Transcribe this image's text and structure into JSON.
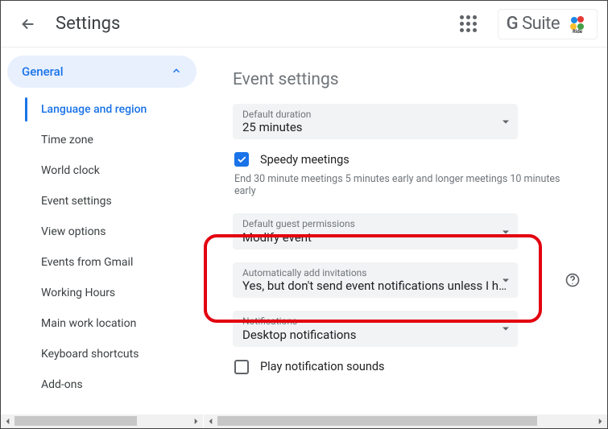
{
  "header": {
    "title": "Settings",
    "suite_label": "G Suite",
    "profile_label": "Soul\nRide"
  },
  "sidebar": {
    "section": "General",
    "items": [
      {
        "label": "Language and region",
        "active": true
      },
      {
        "label": "Time zone"
      },
      {
        "label": "World clock"
      },
      {
        "label": "Event settings"
      },
      {
        "label": "View options"
      },
      {
        "label": "Events from Gmail"
      },
      {
        "label": "Working Hours"
      },
      {
        "label": "Main work location"
      },
      {
        "label": "Keyboard shortcuts"
      },
      {
        "label": "Add-ons"
      }
    ]
  },
  "content": {
    "section_title": "Event settings",
    "default_duration": {
      "label": "Default duration",
      "value": "25 minutes"
    },
    "speedy": {
      "label": "Speedy meetings",
      "checked": true,
      "hint": "End 30 minute meetings 5 minutes early and longer meetings 10 minutes early"
    },
    "guest_perm": {
      "label": "Default guest permissions",
      "value": "Modify event"
    },
    "auto_invites": {
      "label": "Automatically add invitations",
      "value": "Yes, but don't send event notifications unless I ha…"
    },
    "notifications": {
      "label": "Notifications",
      "value": "Desktop notifications"
    },
    "play_sounds": {
      "label": "Play notification sounds",
      "checked": false
    }
  }
}
